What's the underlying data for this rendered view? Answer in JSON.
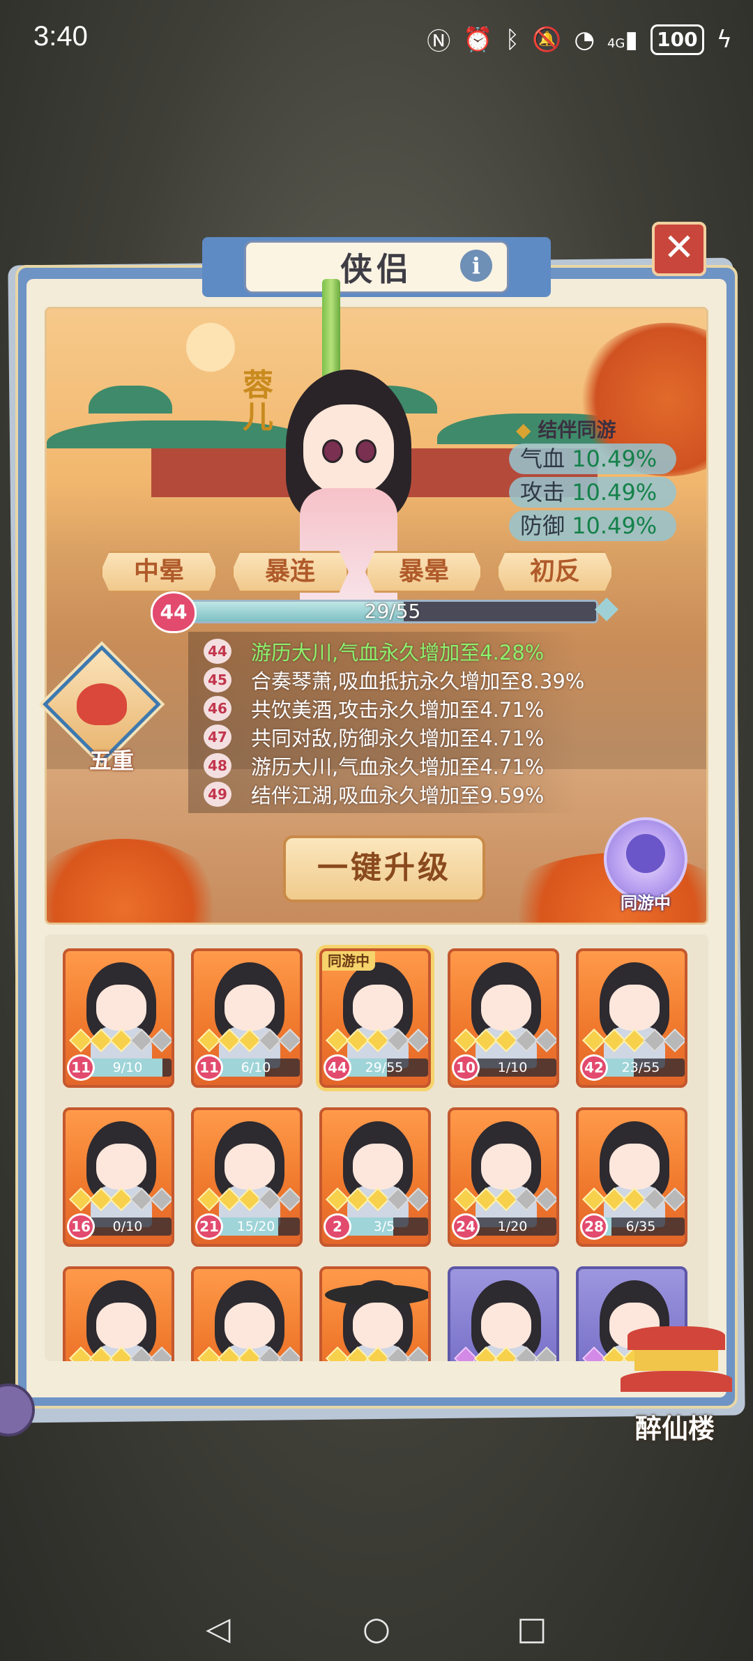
{
  "status_bar": {
    "time": "3:40",
    "icons": [
      "nfc-icon",
      "alarm-icon",
      "bluetooth-icon",
      "mute-icon",
      "wifi-icon",
      "signal-4g-icon"
    ],
    "network": "4G",
    "battery": "100"
  },
  "dialog": {
    "title": "侠侣",
    "info_label": "i",
    "close_label": "✕"
  },
  "partner": {
    "name": "蓉儿",
    "bond_title": "结伴同游",
    "buffs": [
      {
        "label": "气血",
        "value": "10.49%"
      },
      {
        "label": "攻击",
        "value": "10.49%"
      },
      {
        "label": "防御",
        "value": "10.49%"
      }
    ],
    "skills": [
      "中晕",
      "暴连",
      "暴晕",
      "初反"
    ],
    "level": "44",
    "xp_text": "29/55",
    "xp_fraction": 0.527,
    "perks": [
      {
        "level": "44",
        "text": "游历大川,气血永久增加至4.28%",
        "active": true
      },
      {
        "level": "45",
        "text": "合奏琴萧,吸血抵抗永久增加至8.39%",
        "active": false
      },
      {
        "level": "46",
        "text": "共饮美酒,攻击永久增加至4.71%",
        "active": false
      },
      {
        "level": "47",
        "text": "共同对敌,防御永久增加至4.71%",
        "active": false
      },
      {
        "level": "48",
        "text": "游历大川,气血永久增加至4.71%",
        "active": false
      },
      {
        "level": "49",
        "text": "结伴江湖,吸血永久增加至9.59%",
        "active": false
      }
    ],
    "emblem_label": "五重",
    "upgrade_label": "一键升级",
    "travel_label": "同游中"
  },
  "roster": {
    "selected_tag": "同游中",
    "cards": [
      {
        "level": "11",
        "progress": "9/10",
        "fill": 0.9,
        "theme": "orange"
      },
      {
        "level": "11",
        "progress": "6/10",
        "fill": 0.6,
        "theme": "orange"
      },
      {
        "level": "44",
        "progress": "29/55",
        "fill": 0.53,
        "theme": "orange",
        "selected": true
      },
      {
        "level": "10",
        "progress": "1/10",
        "fill": 0.1,
        "theme": "orange"
      },
      {
        "level": "42",
        "progress": "23/55",
        "fill": 0.42,
        "theme": "orange"
      },
      {
        "level": "16",
        "progress": "0/10",
        "fill": 0.0,
        "theme": "orange"
      },
      {
        "level": "21",
        "progress": "15/20",
        "fill": 0.75,
        "theme": "orange"
      },
      {
        "level": "2",
        "progress": "3/5",
        "fill": 0.6,
        "theme": "orange"
      },
      {
        "level": "24",
        "progress": "1/20",
        "fill": 0.05,
        "theme": "orange"
      },
      {
        "level": "28",
        "progress": "6/35",
        "fill": 0.17,
        "theme": "orange"
      },
      {
        "theme": "orange"
      },
      {
        "theme": "orange"
      },
      {
        "theme": "orange",
        "hat": true
      },
      {
        "theme": "purple"
      },
      {
        "theme": "purple"
      }
    ]
  },
  "building": {
    "label": "醉仙楼"
  },
  "nav": {
    "back": "◁",
    "home": "○",
    "recents": "□"
  }
}
